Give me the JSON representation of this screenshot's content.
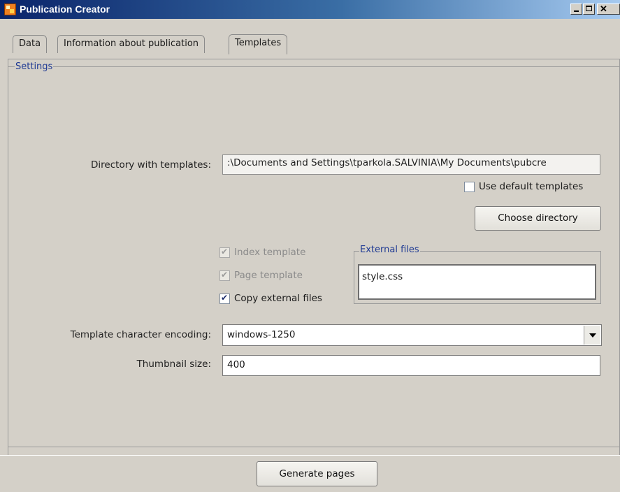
{
  "window": {
    "title": "Publication Creator"
  },
  "tabs": [
    {
      "label": "Data",
      "selected": false
    },
    {
      "label": "Information about publication",
      "selected": false
    },
    {
      "label": "Templates",
      "selected": true
    }
  ],
  "settings": {
    "legend": "Settings",
    "directory": {
      "label": "Directory with templates:",
      "value": ":\\Documents and Settings\\tparkola.SALVINIA\\My Documents\\pubcre"
    },
    "use_default": {
      "label": "Use default templates",
      "checked": false
    },
    "choose_button": "Choose directory",
    "index_template": {
      "label": "Index template",
      "checked": true,
      "enabled": false
    },
    "page_template": {
      "label": "Page template",
      "checked": true,
      "enabled": false
    },
    "copy_external": {
      "label": "Copy external files",
      "checked": true,
      "enabled": true
    },
    "external_files": {
      "legend": "External files",
      "items": [
        "style.css"
      ]
    },
    "encoding": {
      "label": "Template character encoding:",
      "value": "windows-1250"
    },
    "thumbnail": {
      "label": "Thumbnail size:",
      "value": "400"
    }
  },
  "footer": {
    "generate_button": "Generate pages"
  },
  "colors": {
    "title_gradient_start": "#0a246a",
    "legend_text": "#1f3a93",
    "window_bg": "#d4d0c8"
  }
}
